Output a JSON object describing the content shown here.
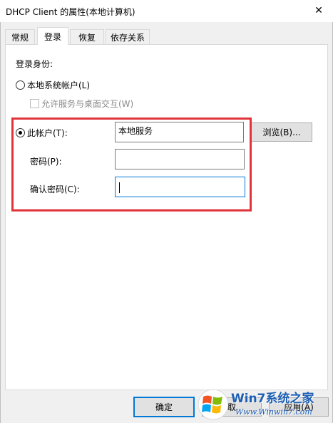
{
  "window": {
    "title": "DHCP Client 的属性(本地计算机)",
    "close_glyph": "✕"
  },
  "tabs": [
    {
      "label": "常规",
      "active": false
    },
    {
      "label": "登录",
      "active": true
    },
    {
      "label": "恢复",
      "active": false
    },
    {
      "label": "依存关系",
      "active": false
    }
  ],
  "logon": {
    "section_label": "登录身份:",
    "local_system_label": "本地系统帐户(L)",
    "local_system_selected": false,
    "interact_desktop_label": "允许服务与桌面交互(W)",
    "interact_desktop_checked": false,
    "this_account_label": "此帐户(T):",
    "this_account_selected": true,
    "account_value": "本地服务",
    "browse_label": "浏览(B)...",
    "password_label": "密码(P):",
    "password_value": "",
    "confirm_password_label": "确认密码(C):",
    "confirm_password_value": ""
  },
  "footer": {
    "ok_label": "确定",
    "cancel_label": "取",
    "apply_label": "应用(A)"
  },
  "watermark": {
    "brand": "Win7系统之家",
    "url": "Www.Winwin7.com"
  },
  "colors": {
    "highlight_border": "#e0343a",
    "focus_border": "#0078d7",
    "watermark_text": "#1e5fb3"
  }
}
